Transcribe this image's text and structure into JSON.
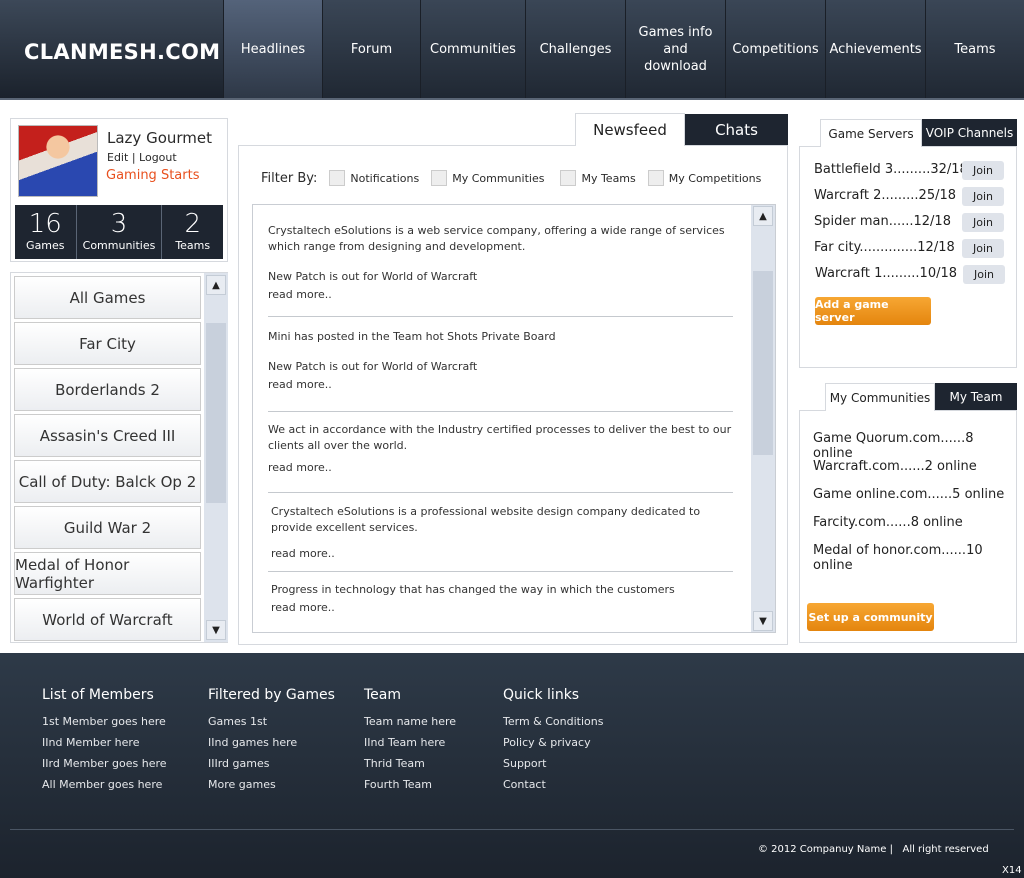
{
  "logo": "CLANMESH.COM",
  "nav": [
    "Headlines",
    "Forum",
    "Communities",
    "Challenges",
    "Games info and download",
    "Competitions",
    "Achievements",
    "Teams"
  ],
  "profile": {
    "name": "Lazy Gourmet",
    "edit": "Edit",
    "sep": "|",
    "logout": "Logout",
    "status": "Gaming Starts",
    "stats": [
      {
        "n": "16",
        "l": "Games"
      },
      {
        "n": "3",
        "l": "Communities"
      },
      {
        "n": "2",
        "l": "Teams"
      }
    ]
  },
  "games": [
    "All Games",
    "Far City",
    "Borderlands 2",
    "Assasin's Creed III",
    "Call of Duty: Balck Op 2",
    "Guild War 2",
    "Medal of Honor Warfighter",
    "World of Warcraft"
  ],
  "center": {
    "tabs": [
      "Newsfeed",
      "Chats"
    ],
    "filter_label": "Filter By:",
    "filters": [
      "Notifications",
      "My Communities",
      "My Teams",
      "My Competitions"
    ],
    "posts": [
      {
        "text": "Crystaltech eSolutions is a web service company, offering a wide range of services which range from designing and development.",
        "sub": "New Patch is out for World of Warcraft",
        "more": "read more.."
      },
      {
        "text": "Mini has posted in the Team hot Shots Private Board",
        "sub": "New Patch is out for World of Warcraft",
        "more": "read more.."
      },
      {
        "text": "We act in accordance with the Industry certified processes to deliver the best to our clients all over the world.",
        "sub": "",
        "more": "read more.."
      },
      {
        "text": "Crystaltech eSolutions is a professional website design company dedicated to provide excellent services.",
        "sub": "",
        "more": "read more.."
      },
      {
        "text": "Progress in technology that has changed the way in which the customers",
        "sub": "",
        "more": "read more.."
      }
    ]
  },
  "servers": {
    "tabs": [
      "Game Servers",
      "VOIP Channels"
    ],
    "items": [
      "Battlefield 3.........32/18",
      "Warcraft 2.........25/18",
      "Spider man......12/18",
      "Far city..............12/18",
      "Warcraft 1.........10/18"
    ],
    "join": "Join",
    "add": "Add a game server"
  },
  "communities": {
    "tabs": [
      "My Communities",
      "My Team"
    ],
    "items": [
      "Game Quorum.com......8 online",
      "Warcraft.com......2 online",
      "Game online.com......5 online",
      "Farcity.com......8 online",
      "Medal of honor.com......10 online"
    ],
    "setup": "Set up a community"
  },
  "footer": {
    "cols": [
      {
        "h": "List of Members",
        "items": [
          "1st Member goes here",
          "IInd Member here",
          "IIrd Member goes here",
          "All Member goes here"
        ]
      },
      {
        "h": "Filtered by Games",
        "items": [
          "Games 1st",
          "IInd games here",
          "IIIrd games",
          "More games"
        ]
      },
      {
        "h": "Team",
        "items": [
          "Team name here",
          "IInd Team here",
          "Thrid Team",
          "Fourth Team"
        ]
      },
      {
        "h": "Quick links",
        "items": [
          "Term & Conditions",
          "Policy & privacy",
          "Support",
          "Contact"
        ]
      }
    ],
    "copyright": "© 2012 Companuy Name |   All right reserved",
    "code": "X14"
  },
  "colors": {
    "accent": "#f08c1c",
    "header": "#1e2530",
    "status": "#e8501e"
  }
}
